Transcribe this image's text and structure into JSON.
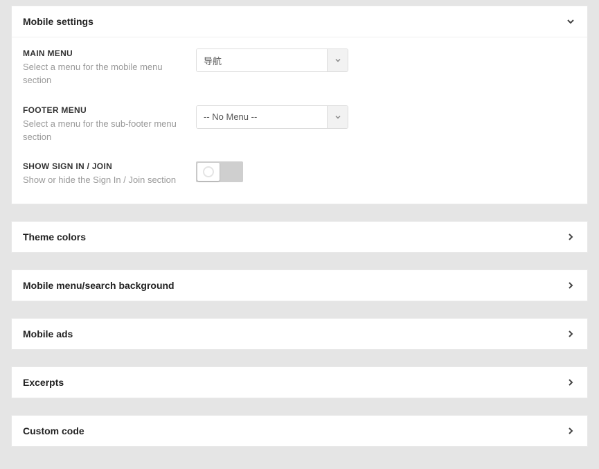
{
  "panels": {
    "mobile_settings": {
      "title": "Mobile settings",
      "expanded": true
    },
    "theme_colors": {
      "title": "Theme colors"
    },
    "mobile_menu_bg": {
      "title": "Mobile menu/search background"
    },
    "mobile_ads": {
      "title": "Mobile ads"
    },
    "excerpts": {
      "title": "Excerpts"
    },
    "custom_code": {
      "title": "Custom code"
    }
  },
  "mobile_settings": {
    "main_menu": {
      "label": "MAIN MENU",
      "help": "Select a menu for the mobile menu section",
      "value": "导航"
    },
    "footer_menu": {
      "label": "FOOTER MENU",
      "help": "Select a menu for the sub-footer menu section",
      "value": "-- No Menu --"
    },
    "show_signin": {
      "label": "SHOW SIGN IN / JOIN",
      "help": "Show or hide the Sign In / Join section",
      "value": false
    }
  }
}
